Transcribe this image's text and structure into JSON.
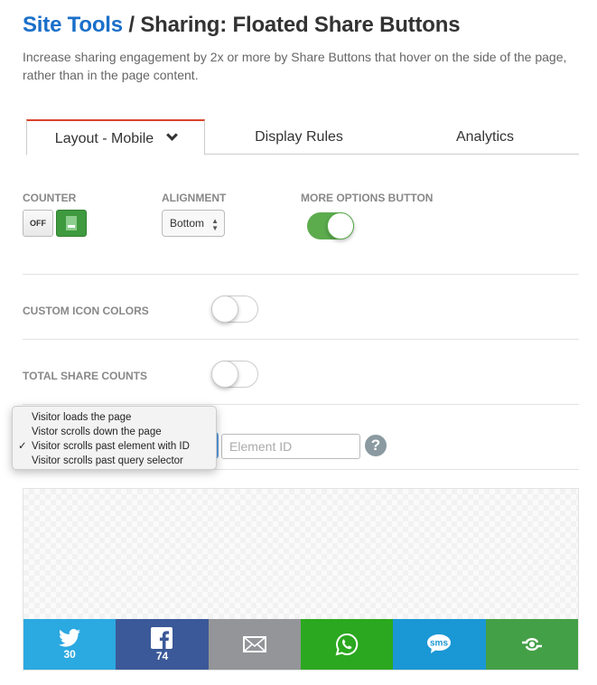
{
  "header": {
    "breadcrumb_link": "Site Tools",
    "separator": " / ",
    "title": "Sharing: Floated Share Buttons",
    "subtitle": "Increase sharing engagement by 2x or more by Share Buttons that hover on the side of the page, rather than in the page content."
  },
  "tabs": [
    {
      "label": "Layout - Mobile",
      "active": true
    },
    {
      "label": "Display Rules"
    },
    {
      "label": "Analytics"
    }
  ],
  "settings": {
    "counter": {
      "label": "COUNTER",
      "off_label": "OFF",
      "state": "on"
    },
    "alignment": {
      "label": "ALIGNMENT",
      "value": "Bottom"
    },
    "more_options": {
      "label": "MORE OPTIONS BUTTON",
      "enabled": true
    },
    "custom_icon_colors": {
      "label": "CUSTOM ICON COLORS",
      "enabled": false
    },
    "total_share_counts": {
      "label": "TOTAL SHARE COUNTS",
      "enabled": false
    }
  },
  "trigger": {
    "options": [
      "Visitor loads the page",
      "Vistor scrolls down the page",
      "Visitor scrolls past element with ID",
      "Visitor scrolls past query selector"
    ],
    "selected_index": 2,
    "check": "✓",
    "element_id_placeholder": "Element ID",
    "help": "?"
  },
  "share_buttons": [
    {
      "icon": "twitter-icon",
      "count": "30",
      "color": "#2ba9e1"
    },
    {
      "icon": "facebook-icon",
      "count": "74",
      "color": "#3b5998"
    },
    {
      "icon": "email-icon",
      "color": "#939598"
    },
    {
      "icon": "whatsapp-icon",
      "color": "#2ba81f"
    },
    {
      "icon": "sms-icon",
      "sms_text": "sms",
      "color": "#1a97d5"
    },
    {
      "icon": "more-options-icon",
      "color": "#44a047"
    }
  ],
  "colors": {
    "link": "#1a6fc9",
    "tab_active_border": "#d9432c",
    "toggle_on": "#5cac4e"
  }
}
